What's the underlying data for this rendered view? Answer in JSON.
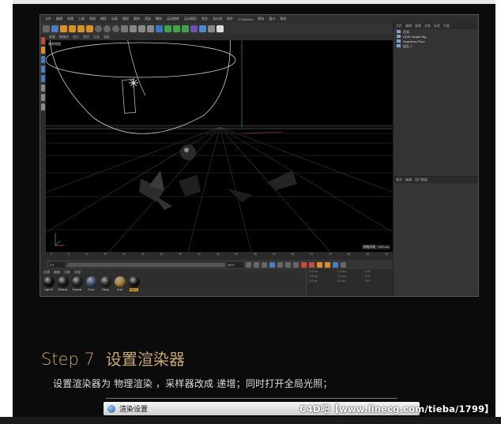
{
  "screenshot": {
    "menubar_items": [
      "文件",
      "编辑",
      "创建",
      "工具",
      "网格",
      "捕捉",
      "动画",
      "模拟",
      "跟踪",
      "渲染",
      "雕刻",
      "运动跟踪",
      "运动图形",
      "角色",
      "流水线",
      "插件",
      "X-Particles",
      "脚本",
      "窗口",
      "帮助"
    ],
    "viewport_header_items": [
      "查看",
      "摄像机",
      "显示",
      "选项",
      "过滤",
      "面板"
    ],
    "viewport_label": "透视视图",
    "grid_distance": "网格间距 : 100 cm",
    "timeline_ticks": [
      "0",
      "5",
      "10",
      "15",
      "20",
      "25",
      "30",
      "35",
      "40",
      "45",
      "50",
      "55",
      "60",
      "65",
      "70",
      "75",
      "80",
      "85",
      "90"
    ],
    "frame_start": "0 F",
    "frame_end": "90 F",
    "object_tabs": [
      "文件",
      "编辑",
      "查看",
      "对象",
      "标签",
      "书签"
    ],
    "objects": [
      "灯光",
      "HDRI Studio Rig",
      "Seamless Floor",
      "宝石 1"
    ],
    "attr_tabs": [
      "模式",
      "编辑",
      "用户数据"
    ],
    "material_tabs": [
      "创建",
      "编辑",
      "功能",
      "纹理"
    ],
    "materials": [
      "Light M",
      "Reflecti",
      "Seamle",
      "Floor",
      "Glass",
      "Gold",
      "Mat.1"
    ],
    "coord_rows": [
      [
        "X 0 cm",
        "X 0 cm",
        "H 0°"
      ],
      [
        "Y 0 cm",
        "Y 0 cm",
        "P 0°"
      ],
      [
        "Z 0 cm",
        "Z 0 cm",
        "B 0°"
      ]
    ]
  },
  "article": {
    "step_number": "Step 7",
    "step_title": "设置渲染器",
    "description": "设置渲染器为 物理渲染 ，采样器改成 递增；同时打开全局光照；",
    "dialog_title": "渲染设置"
  },
  "watermark": "C4D吧【www.linecg.com/tieba/1799】",
  "colors": {
    "article_bg": "#0b0b0b",
    "step_accent": "#c8a86c",
    "viewport_bg": "#000000",
    "ui_panel": "#333333"
  }
}
